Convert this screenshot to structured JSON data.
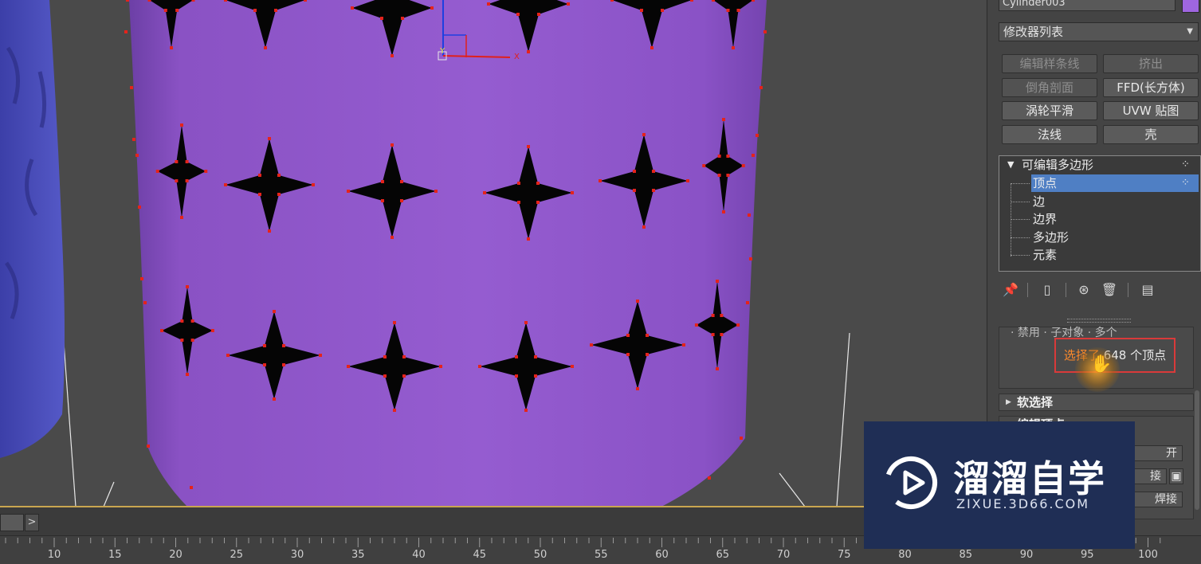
{
  "panel": {
    "object_name": "Cylinder003",
    "object_color": "#9f66e0",
    "modifier_list": "修改器列表",
    "modifier_buttons": [
      {
        "label": "编辑样条线",
        "enabled": false
      },
      {
        "label": "挤出",
        "enabled": false
      },
      {
        "label": "倒角剖面",
        "enabled": false
      },
      {
        "label": "FFD(长方体)",
        "enabled": true
      },
      {
        "label": "涡轮平滑",
        "enabled": true
      },
      {
        "label": "UVW 贴图",
        "enabled": true
      },
      {
        "label": "法线",
        "enabled": true
      },
      {
        "label": "壳",
        "enabled": true
      }
    ],
    "stack": {
      "root": "可编辑多边形",
      "sub_objects": [
        "顶点",
        "边",
        "边界",
        "多边形",
        "元素"
      ],
      "selected": "顶点"
    },
    "stack_tools": [
      "pin-icon",
      "show-end-result-icon",
      "make-unique-icon",
      "remove-modifier-icon",
      "configure-sets-icon"
    ],
    "selection_rollout": {
      "partial_row": "· 禁用 · 子对象 · 多个",
      "status_text": "选择了 648 个顶点"
    },
    "soft_selection_title": "软选择",
    "edit_vertices": {
      "title": "编辑顶点",
      "buttons": [
        "开",
        "接",
        "焊接"
      ]
    }
  },
  "timeline": {
    "ticks": [
      "10",
      "15",
      "20",
      "25",
      "30",
      "35",
      "40",
      "45",
      "50",
      "55",
      "60",
      "65",
      "70",
      "75",
      "80",
      "85",
      "90",
      "95",
      "100"
    ],
    "next_symbol": ">"
  },
  "viewport": {
    "gizmo_labels": {
      "x": "X",
      "y": "Y"
    }
  },
  "watermark": {
    "title": "溜溜自学",
    "url": "ZIXUE.3D66.COM"
  },
  "colors": {
    "cylinder": "#8f57c8",
    "vertex": "#e5231b",
    "selection_box": "#d93a3a",
    "stack_highlight": "#4f7fc4",
    "watermark_bg": "#1f2e55"
  }
}
